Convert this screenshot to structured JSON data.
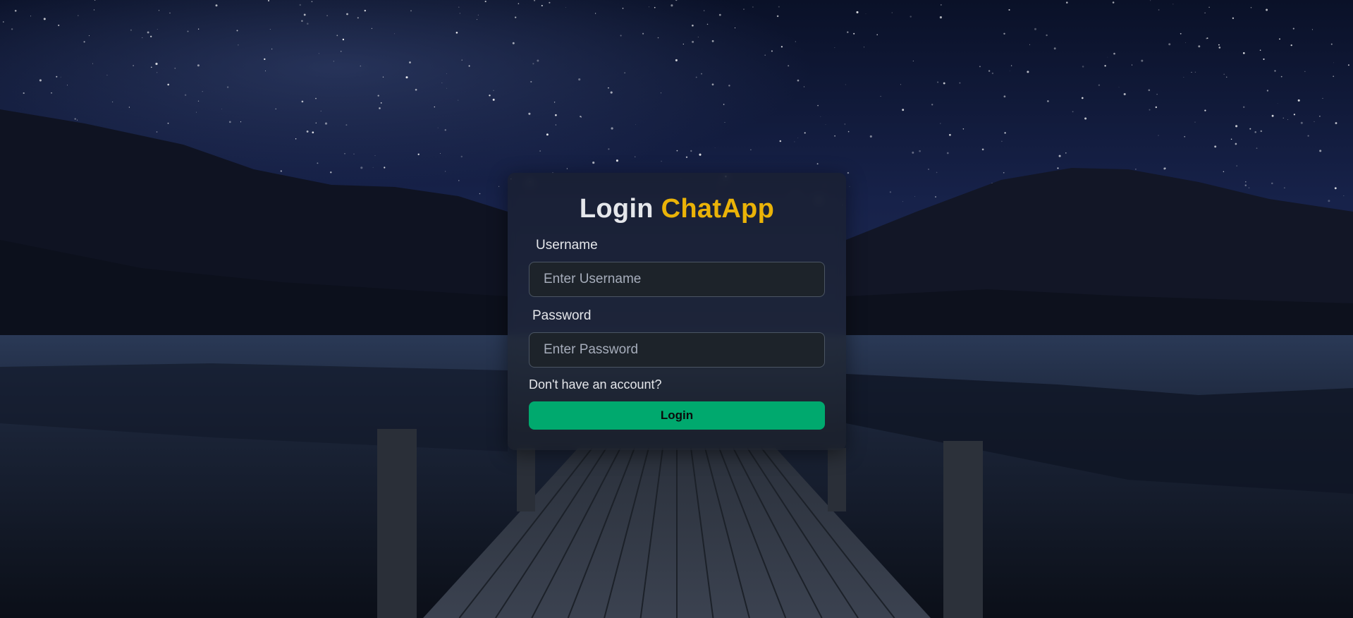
{
  "login_form": {
    "title_word": "Login",
    "title_brand": "ChatApp",
    "username_label": "Username",
    "username_placeholder": "Enter Username",
    "username_value": "",
    "password_label": "Password",
    "password_placeholder": "Enter Password",
    "password_value": "",
    "signup_link": "Don't have an account?",
    "submit_label": "Login"
  },
  "colors": {
    "brand": "#eab308",
    "button": "#00a96e",
    "text": "#e5e7eb"
  }
}
